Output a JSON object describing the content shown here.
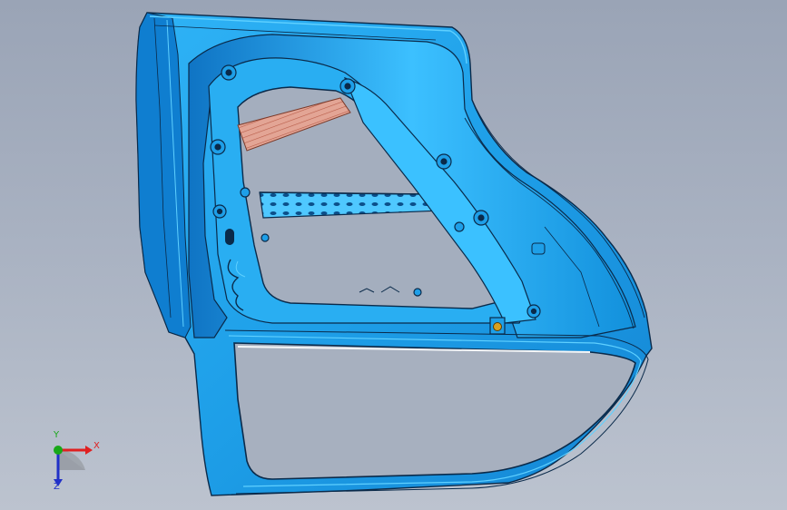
{
  "viewport": {
    "background_top": "#9aa4b6",
    "background_bottom": "#bcc3cf"
  },
  "model": {
    "part_color": "#1e9fe8",
    "part_highlight": "#47c4ff",
    "part_shadow": "#0b5fa8",
    "edge_color": "#0a2a4a",
    "hatch_color": "#d9826f"
  },
  "triad": {
    "x_label": "X",
    "y_label": "Y",
    "z_label": "Z",
    "x_color": "#e02020",
    "y_color": "#18a818",
    "z_color": "#2030c8",
    "x_icon": "axis-x-arrow",
    "y_icon": "axis-y-dot",
    "z_icon": "axis-z-arrow"
  }
}
